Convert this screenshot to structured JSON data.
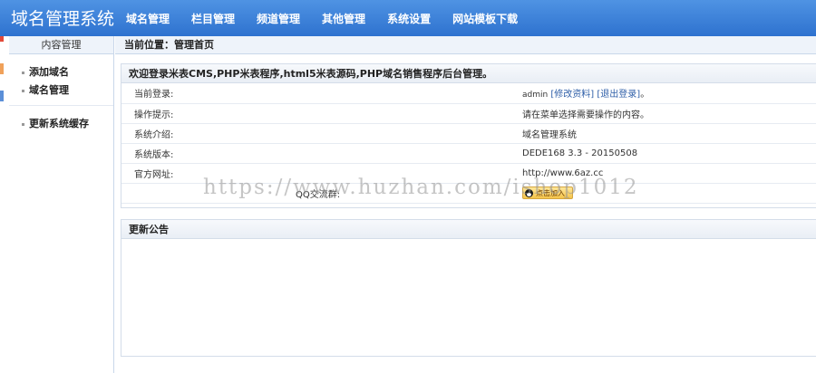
{
  "header": {
    "title": "域名管理系统",
    "nav": [
      "域名管理",
      "栏目管理",
      "频道管理",
      "其他管理",
      "系统设置",
      "网站模板下载"
    ]
  },
  "sidebar": {
    "heading": "内容管理",
    "groups": [
      {
        "items": [
          "添加域名",
          "域名管理"
        ]
      },
      {
        "items": [
          "更新系统缓存"
        ]
      }
    ]
  },
  "breadcrumb": "当前位置：管理首页",
  "welcome_panel": {
    "title": "欢迎登录米表CMS,PHP米表程序,html5米表源码,PHP域名销售程序后台管理。",
    "rows": [
      {
        "label": "当前登录:",
        "user": "admin",
        "edit_link": "[修改资料]",
        "logout_link": "[退出登录]",
        "suffix": "。"
      },
      {
        "label": "操作提示:",
        "value": "请在菜单选择需要操作的内容。"
      },
      {
        "label": "系统介绍:",
        "value": "域名管理系统"
      },
      {
        "label": "系统版本:",
        "value": "DEDE168 3.3 - 20150508"
      },
      {
        "label": "官方网址:",
        "value": "http://www.6az.cc"
      },
      {
        "label": "QQ交流群:",
        "button": "点击加入"
      }
    ]
  },
  "notice_panel": {
    "title": "更新公告"
  },
  "watermark": "https://www.huzhan.com/ishop1012",
  "colors": {
    "header_top": "#4f93e3",
    "header_bottom": "#2e72cf",
    "link": "#2f5fa8"
  }
}
